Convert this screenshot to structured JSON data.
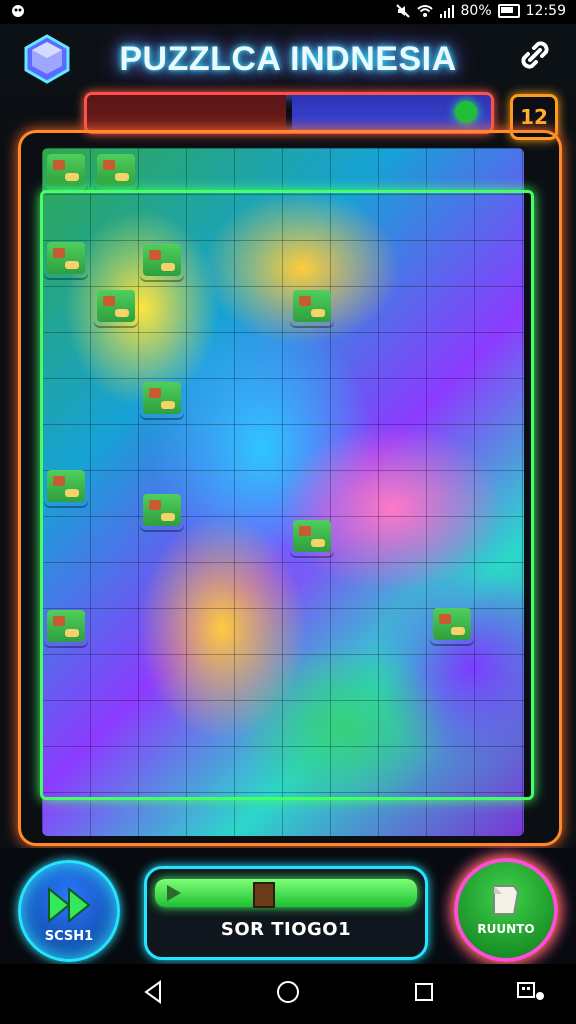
{
  "status_bar": {
    "battery_percent": "80%",
    "time": "12:59",
    "icons": [
      "notification-icon",
      "mute-icon",
      "wifi-icon",
      "signal-icon",
      "battery-icon"
    ]
  },
  "header": {
    "title": "PUZZLCA INDNESIA",
    "icons": [
      "gem-icon",
      "link-icon"
    ]
  },
  "progress": {
    "fraction_filled": 0.5,
    "level_badge": "12"
  },
  "board": {
    "pieces": [
      {
        "name": "board-piece-1",
        "kind": "scene"
      },
      {
        "name": "board-piece-2",
        "kind": "scene"
      },
      {
        "name": "board-piece-3",
        "kind": "scene"
      },
      {
        "name": "board-piece-4",
        "kind": "scene"
      },
      {
        "name": "board-piece-5",
        "kind": "scene"
      },
      {
        "name": "board-piece-6",
        "kind": "scene"
      },
      {
        "name": "board-piece-7",
        "kind": "scene"
      },
      {
        "name": "board-piece-8",
        "kind": "scene"
      },
      {
        "name": "board-piece-9",
        "kind": "scene"
      },
      {
        "name": "board-piece-10",
        "kind": "scene"
      },
      {
        "name": "board-piece-11",
        "kind": "scene"
      },
      {
        "name": "board-piece-12",
        "kind": "scene"
      }
    ]
  },
  "controls": {
    "left_button_label": "SCSH1",
    "center_button_text": "SOR TIOGO1",
    "right_button_label": "RUUNTO"
  },
  "colors": {
    "neon_cyan": "#26e3ff",
    "neon_green": "#45ff66",
    "neon_orange": "#ff8a2a",
    "neon_pink": "#ff4dd8",
    "timer_red": "#ff4f4f",
    "timer_blue": "#3a46d8"
  }
}
